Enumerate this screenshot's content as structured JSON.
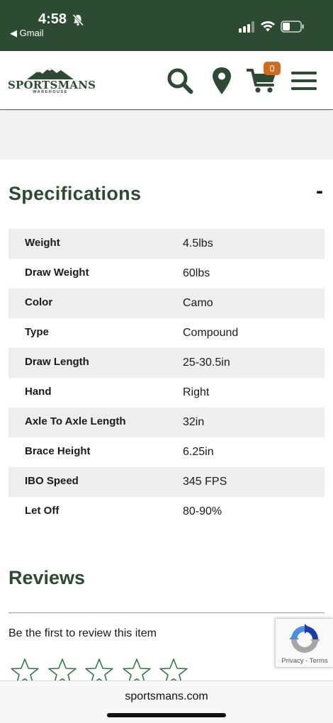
{
  "status_bar": {
    "time": "4:58",
    "back_app": "◀ Gmail"
  },
  "header": {
    "logo_text": "SPORTSMANS",
    "logo_subtext": "WAREHOUSE",
    "cart_count": "0",
    "icons": [
      "search-icon",
      "location-icon",
      "cart-icon",
      "menu-icon"
    ],
    "brand_color": "#2d4a33",
    "badge_color": "#d26a1c"
  },
  "specifications": {
    "title": "Specifications",
    "collapse_label": "-",
    "rows": [
      {
        "label": "Weight",
        "value": "4.5lbs"
      },
      {
        "label": "Draw Weight",
        "value": "60lbs"
      },
      {
        "label": "Color",
        "value": "Camo"
      },
      {
        "label": "Type",
        "value": "Compound"
      },
      {
        "label": "Draw Length",
        "value": "25-30.5in"
      },
      {
        "label": "Hand",
        "value": "Right"
      },
      {
        "label": "Axle To Axle Length",
        "value": "32in"
      },
      {
        "label": "Brace Height",
        "value": "6.25in"
      },
      {
        "label": "IBO Speed",
        "value": "345 FPS"
      },
      {
        "label": "Let Off",
        "value": "80-90%"
      }
    ]
  },
  "reviews": {
    "title": "Reviews",
    "prompt": "Be the first to review this item",
    "star_count": 5
  },
  "recaptcha": {
    "links": "Privacy - Terms"
  },
  "browser": {
    "url": "sportsmans.com"
  }
}
